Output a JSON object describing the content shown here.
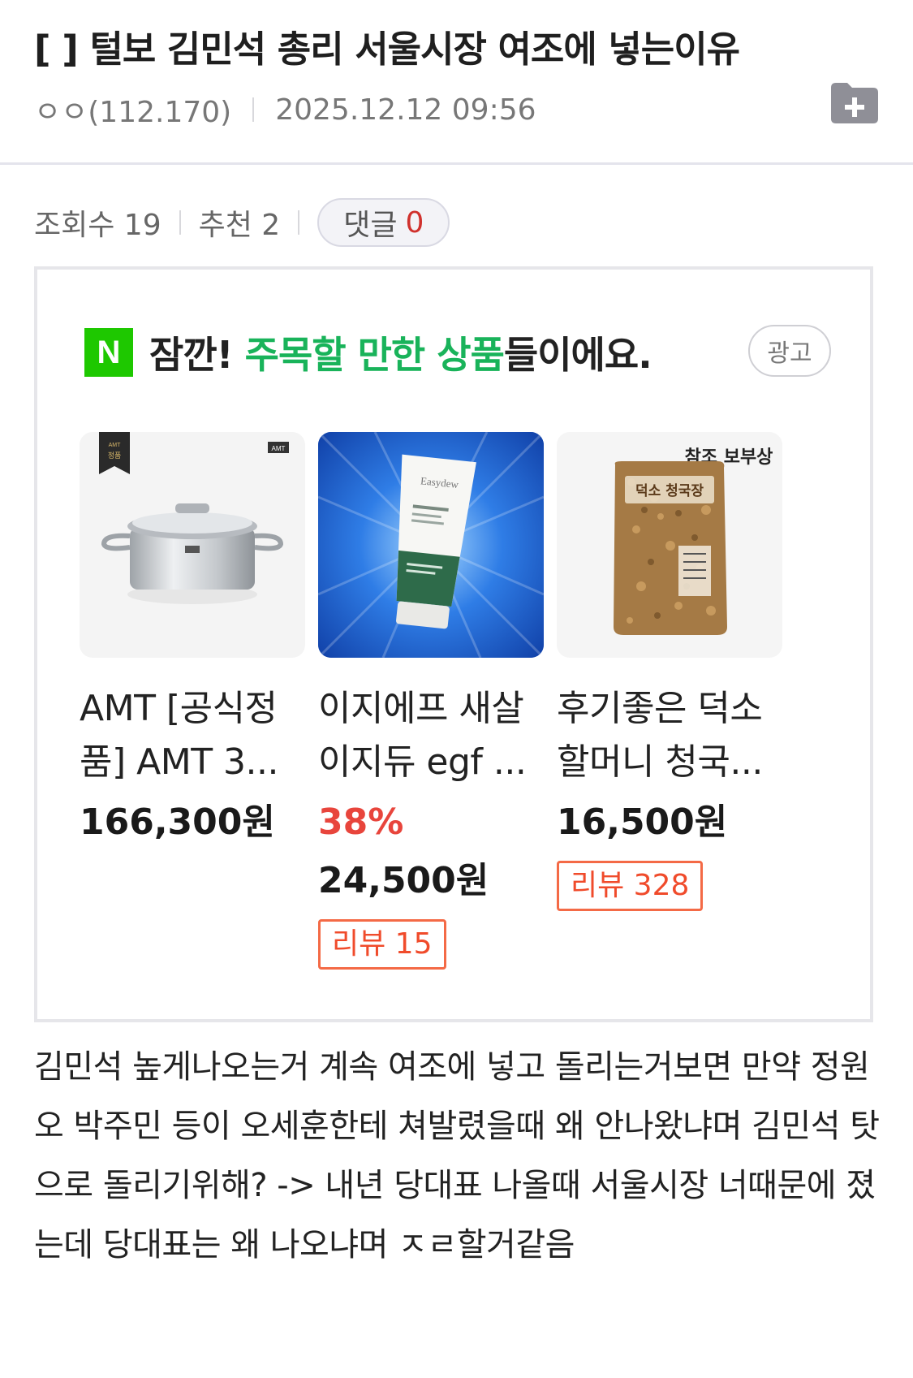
{
  "post": {
    "title": "[  ] 털보 김민석 총리 서울시장 여조에 넣는이유",
    "author": "ㅇㅇ(112.170)",
    "datetime": "2025.12.12 09:56"
  },
  "stats": {
    "views_label": "조회수 19",
    "recommend_label": "추천 2",
    "comments_label": "댓글",
    "comments_count": "0"
  },
  "ad": {
    "title_prefix": "잠깐! ",
    "title_highlight": "주목할 만한 상품",
    "title_suffix": "들이에요.",
    "badge": "광고",
    "logo_letter": "N",
    "products": [
      {
        "name": "AMT [공식정품] AMT 3...",
        "price": "166,300원",
        "thumb_tag": "AMT 정품",
        "brand_mark": "AMT"
      },
      {
        "name": "이지에프 새살 이지듀 egf ...",
        "discount": "38%",
        "price": "24,500원",
        "review": "리뷰 15",
        "tube_brand": "Easydew"
      },
      {
        "name": "후기좋은 덕소 할머니 청국...",
        "price": "16,500원",
        "review": "리뷰 328",
        "brand_mark": "참조 보부상",
        "bag_label": "덕소 청국장"
      }
    ]
  },
  "content": {
    "text": "김민석 높게나오는거 계속 여조에 넣고 돌리는거보면 만약 정원오 박주민 등이 오세훈한테 쳐발렸을때 왜 안나왔냐며 김민석 탓으로 돌리기위해? -> 내년 당대표 나올때 서울시장 너때문에 졌는데 당대표는 왜 나오냐며 ㅈㄹ할거같음"
  },
  "colors": {
    "accent_green": "#19b35a",
    "naver_green": "#1ec800",
    "comment_count_red": "#d0312d",
    "discount_red": "#e8453c",
    "review_orange": "#f04b2b"
  }
}
